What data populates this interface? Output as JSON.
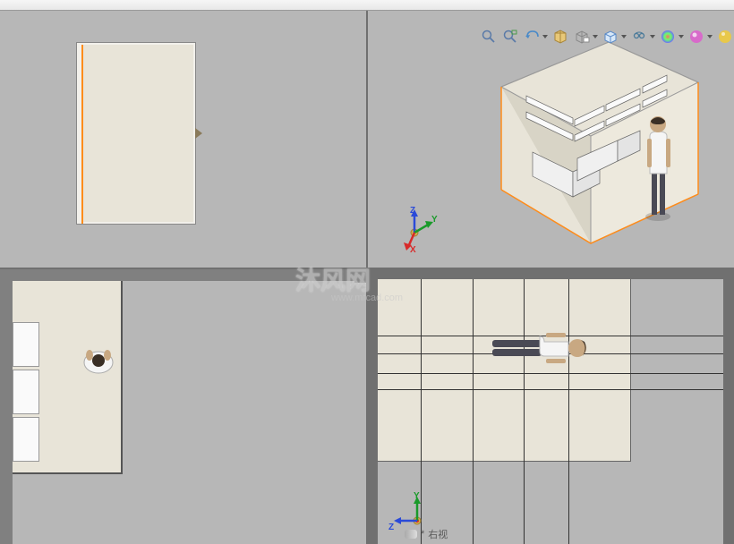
{
  "watermark": {
    "text": "沐风网",
    "url": "www.mfcad.com"
  },
  "toolbar": {
    "zoom_to_fit": "zoom-to-fit",
    "zoom_area": "zoom-area",
    "prev_view": "previous-view",
    "section_view": "section-view",
    "view_orientation": "view-orientation",
    "display_style": "display-style",
    "hide_show": "hide-show-items",
    "edit_appearance": "edit-appearance",
    "apply_scene": "apply-scene",
    "view_settings": "view-settings"
  },
  "triad": {
    "axes_3d": {
      "x": "X",
      "y": "Y",
      "z": "Z"
    },
    "axes_2d": {
      "y": "Y",
      "z": "Z"
    }
  },
  "view_label": {
    "symbol": "*",
    "name": "右视"
  }
}
